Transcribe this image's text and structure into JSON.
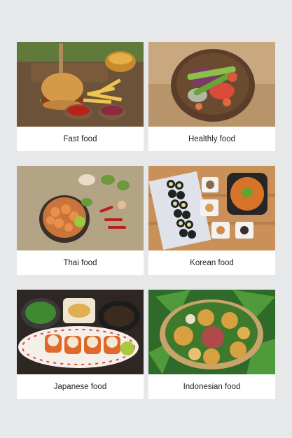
{
  "cards": [
    {
      "label": "Fast food",
      "image": "burger-fries-photo"
    },
    {
      "label": "Healthly food",
      "image": "salad-bowl-photo"
    },
    {
      "label": "Thai food",
      "image": "shrimp-dish-photo"
    },
    {
      "label": "Korean food",
      "image": "kimbap-banchan-photo"
    },
    {
      "label": "Japanese food",
      "image": "sushi-rolls-photo"
    },
    {
      "label": "Indonesian food",
      "image": "banana-leaf-platter-photo"
    }
  ],
  "colors": {
    "page_background": "#e7e8ea",
    "card_background": "#ffffff",
    "label_text": "#1f1f1f"
  }
}
